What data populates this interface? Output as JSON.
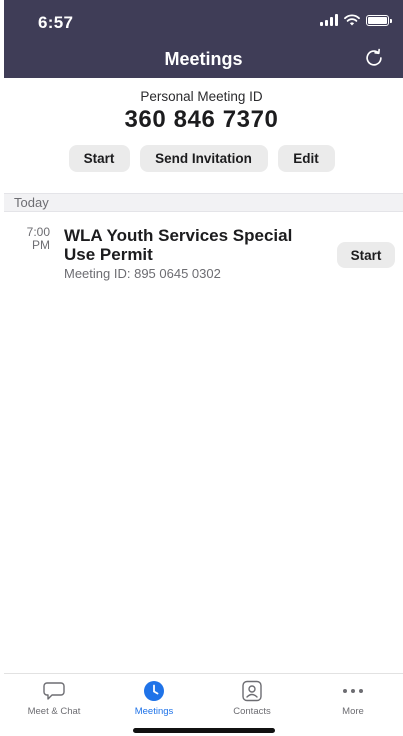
{
  "status_bar": {
    "time": "6:57"
  },
  "header": {
    "title": "Meetings",
    "refresh_icon": "refresh-icon"
  },
  "personal_meeting": {
    "label": "Personal Meeting ID",
    "number": "360 846 7370",
    "buttons": {
      "start": "Start",
      "send_invitation": "Send Invitation",
      "edit": "Edit"
    }
  },
  "section": {
    "label": "Today"
  },
  "meetings": [
    {
      "time": "7:00",
      "period": "PM",
      "title": "WLA Youth Services Special Use Permit",
      "meeting_id": "Meeting ID: 895 0645 0302",
      "start_label": "Start"
    }
  ],
  "tabbar": {
    "items": [
      {
        "label": "Meet & Chat",
        "icon": "chat-bubble-icon",
        "active": false
      },
      {
        "label": "Meetings",
        "icon": "clock-icon",
        "active": true
      },
      {
        "label": "Contacts",
        "icon": "contact-icon",
        "active": false
      },
      {
        "label": "More",
        "icon": "more-icon",
        "active": false
      }
    ]
  },
  "colors": {
    "header_bg": "#3f3d57",
    "accent": "#1f73e8",
    "pill_bg": "#ebebeb",
    "secondary_text": "#6d6d72"
  }
}
